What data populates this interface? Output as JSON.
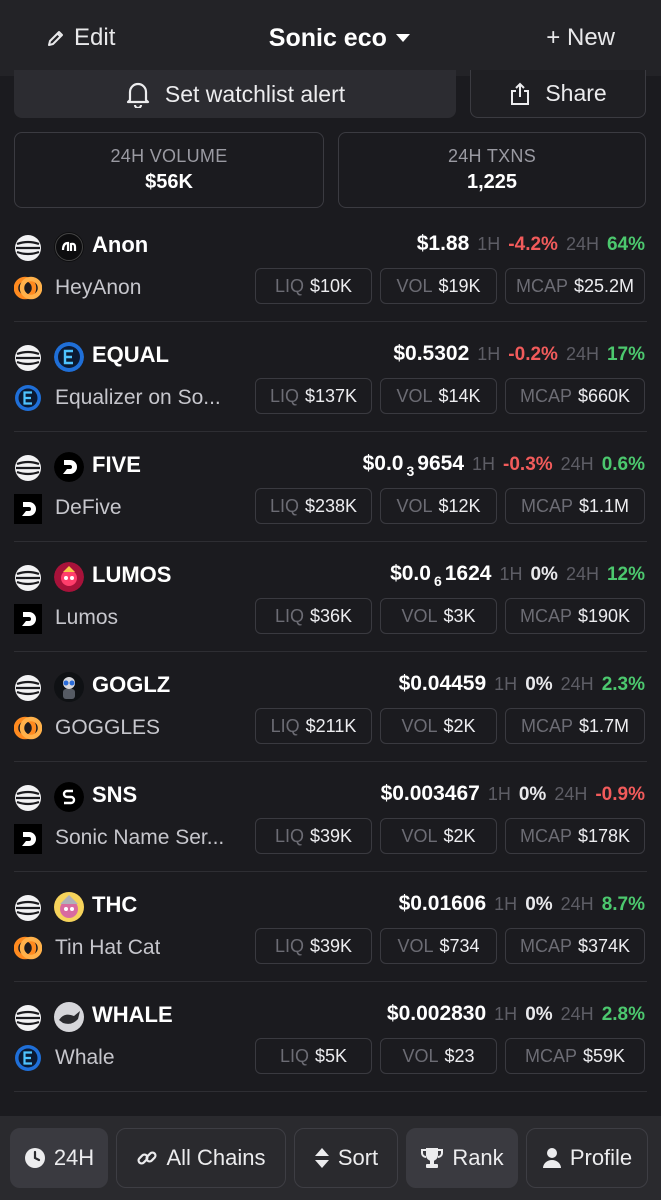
{
  "header": {
    "edit_label": "Edit",
    "title": "Sonic eco",
    "new_label": "+ New"
  },
  "actions": {
    "alert_label": "Set watchlist alert",
    "share_label": "Share"
  },
  "stats": [
    {
      "label": "24H VOLUME",
      "value": "$56K"
    },
    {
      "label": "24H TXNS",
      "value": "1,225"
    }
  ],
  "tokens": [
    {
      "symbol": "Anon",
      "name": "HeyAnon",
      "price_main": "$1.88",
      "price_sub": "",
      "price_tail": "",
      "h1_label": "1H",
      "h1": "-4.2%",
      "h1_dir": "neg",
      "h24_label": "24H",
      "h24": "64%",
      "h24_dir": "pos",
      "liq_label": "LIQ",
      "liq": "$10K",
      "vol_label": "VOL",
      "vol": "$19K",
      "mcap_label": "MCAP",
      "mcap": "$25.2M",
      "token_icon": "anon-logo-icon",
      "dex_icon": "orange-ring-dex-icon"
    },
    {
      "symbol": "EQUAL",
      "name": "Equalizer on So...",
      "price_main": "$0.5302",
      "price_sub": "",
      "price_tail": "",
      "h1_label": "1H",
      "h1": "-0.2%",
      "h1_dir": "neg",
      "h24_label": "24H",
      "h24": "17%",
      "h24_dir": "pos",
      "liq_label": "LIQ",
      "liq": "$137K",
      "vol_label": "VOL",
      "vol": "$14K",
      "mcap_label": "MCAP",
      "mcap": "$660K",
      "token_icon": "equalizer-logo-icon",
      "dex_icon": "equalizer-dex-icon"
    },
    {
      "symbol": "FIVE",
      "name": "DeFive",
      "price_main": "$0.0",
      "price_sub": "3",
      "price_tail": "9654",
      "h1_label": "1H",
      "h1": "-0.3%",
      "h1_dir": "neg",
      "h24_label": "24H",
      "h24": "0.6%",
      "h24_dir": "pos",
      "liq_label": "LIQ",
      "liq": "$238K",
      "vol_label": "VOL",
      "vol": "$12K",
      "mcap_label": "MCAP",
      "mcap": "$1.1M",
      "token_icon": "defive-logo-icon",
      "dex_icon": "defive-dex-icon"
    },
    {
      "symbol": "LUMOS",
      "name": "Lumos",
      "price_main": "$0.0",
      "price_sub": "6",
      "price_tail": "1624",
      "h1_label": "1H",
      "h1": "0%",
      "h1_dir": "zero",
      "h24_label": "24H",
      "h24": "12%",
      "h24_dir": "pos",
      "liq_label": "LIQ",
      "liq": "$36K",
      "vol_label": "VOL",
      "vol": "$3K",
      "mcap_label": "MCAP",
      "mcap": "$190K",
      "token_icon": "lumos-logo-icon",
      "dex_icon": "defive-dex-icon"
    },
    {
      "symbol": "GOGLZ",
      "name": "GOGGLES",
      "price_main": "$0.04459",
      "price_sub": "",
      "price_tail": "",
      "h1_label": "1H",
      "h1": "0%",
      "h1_dir": "zero",
      "h24_label": "24H",
      "h24": "2.3%",
      "h24_dir": "pos",
      "liq_label": "LIQ",
      "liq": "$211K",
      "vol_label": "VOL",
      "vol": "$2K",
      "mcap_label": "MCAP",
      "mcap": "$1.7M",
      "token_icon": "goglz-logo-icon",
      "dex_icon": "orange-ring-dex-icon"
    },
    {
      "symbol": "SNS",
      "name": "Sonic Name Ser...",
      "price_main": "$0.003467",
      "price_sub": "",
      "price_tail": "",
      "h1_label": "1H",
      "h1": "0%",
      "h1_dir": "zero",
      "h24_label": "24H",
      "h24": "-0.9%",
      "h24_dir": "neg",
      "liq_label": "LIQ",
      "liq": "$39K",
      "vol_label": "VOL",
      "vol": "$2K",
      "mcap_label": "MCAP",
      "mcap": "$178K",
      "token_icon": "sns-logo-icon",
      "dex_icon": "defive-dex-icon"
    },
    {
      "symbol": "THC",
      "name": "Tin Hat Cat",
      "price_main": "$0.01606",
      "price_sub": "",
      "price_tail": "",
      "h1_label": "1H",
      "h1": "0%",
      "h1_dir": "zero",
      "h24_label": "24H",
      "h24": "8.7%",
      "h24_dir": "pos",
      "liq_label": "LIQ",
      "liq": "$39K",
      "vol_label": "VOL",
      "vol": "$734",
      "mcap_label": "MCAP",
      "mcap": "$374K",
      "token_icon": "thc-logo-icon",
      "dex_icon": "orange-ring-dex-icon"
    },
    {
      "symbol": "WHALE",
      "name": "Whale",
      "price_main": "$0.002830",
      "price_sub": "",
      "price_tail": "",
      "h1_label": "1H",
      "h1": "0%",
      "h1_dir": "zero",
      "h24_label": "24H",
      "h24": "2.8%",
      "h24_dir": "pos",
      "liq_label": "LIQ",
      "liq": "$5K",
      "vol_label": "VOL",
      "vol": "$23",
      "mcap_label": "MCAP",
      "mcap": "$59K",
      "token_icon": "whale-logo-icon",
      "dex_icon": "equalizer-dex-icon"
    }
  ],
  "bottom_nav": [
    {
      "label": "24H",
      "icon": "clock-icon"
    },
    {
      "label": "All Chains",
      "icon": "link-icon"
    },
    {
      "label": "Sort",
      "icon": "sort-arrows-icon"
    },
    {
      "label": "Rank",
      "icon": "trophy-icon"
    },
    {
      "label": "Profile",
      "icon": "user-icon"
    }
  ],
  "colors": {
    "background": "#1b1b1f",
    "positive": "#4cc86e",
    "negative": "#f25b5b",
    "muted": "#6c6c74"
  }
}
